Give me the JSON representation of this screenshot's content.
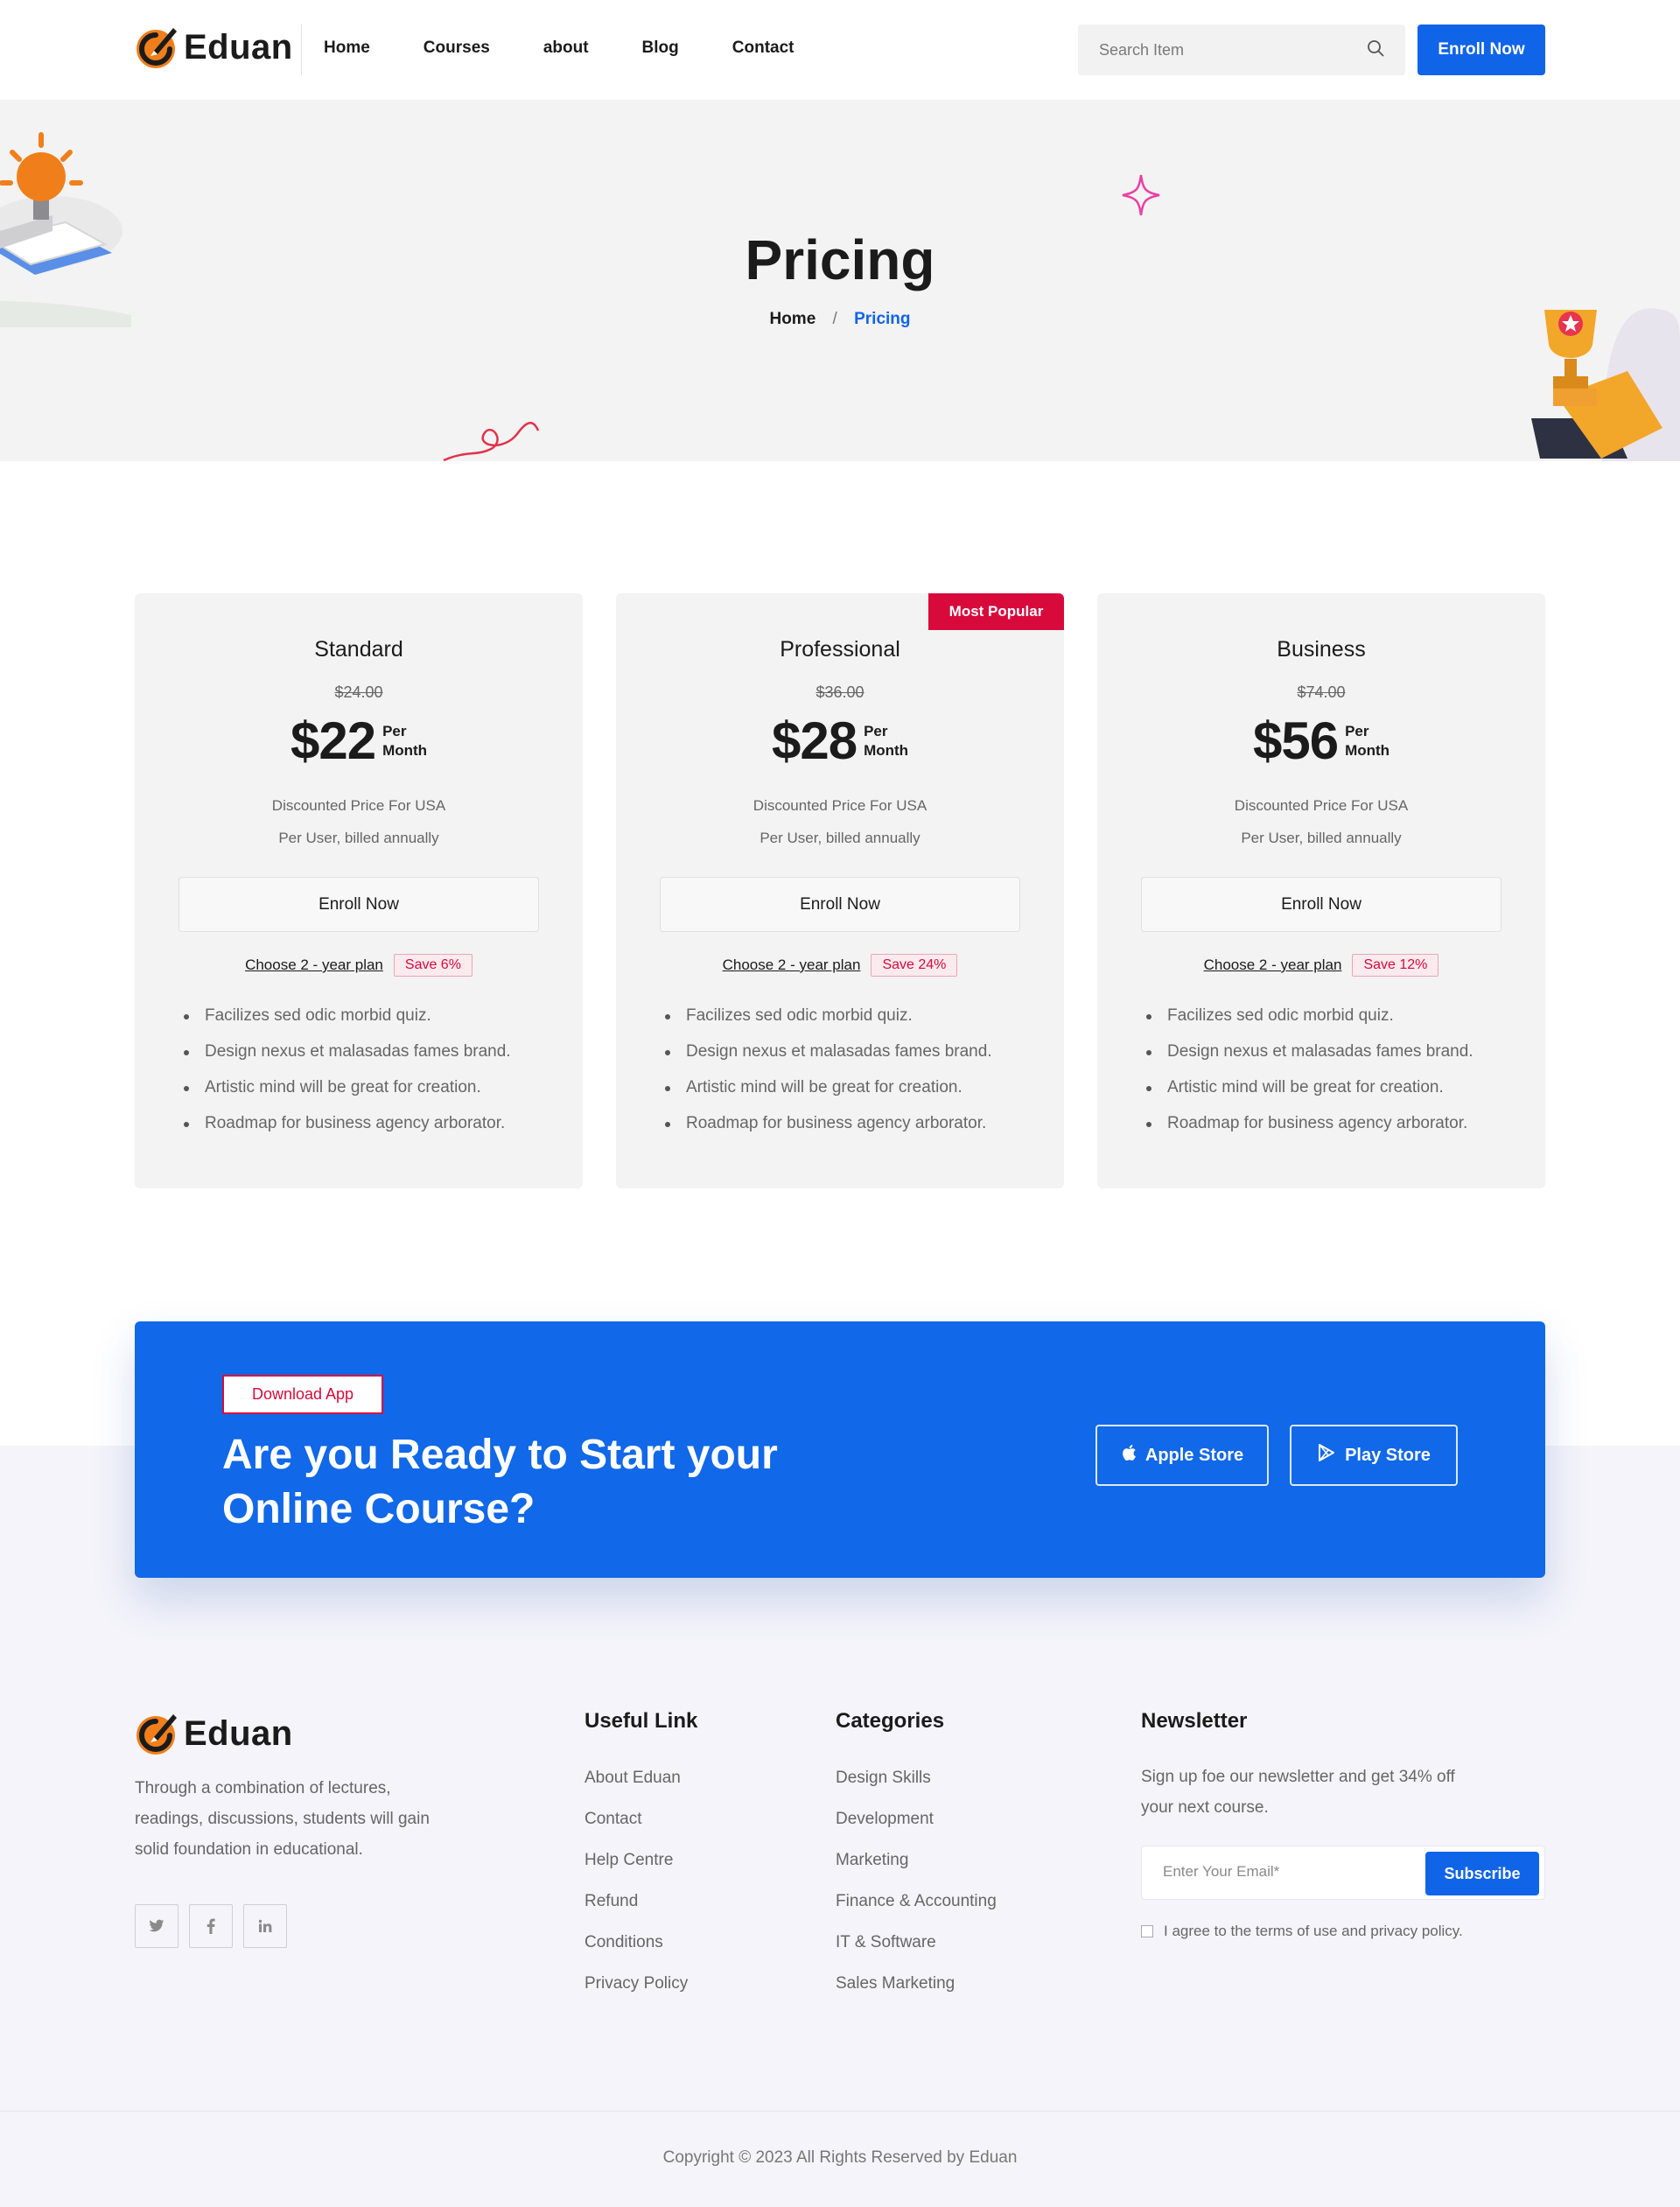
{
  "brand": {
    "name": "Eduan",
    "accent": "#1064e8",
    "orange": "#f07f1b",
    "red": "#d80a3c"
  },
  "nav": {
    "items": [
      "Home",
      "Courses",
      "about",
      "Blog",
      "Contact"
    ]
  },
  "header": {
    "search_placeholder": "Search Item",
    "enroll_label": "Enroll Now",
    "search_icon": "search-icon"
  },
  "hero": {
    "title": "Pricing",
    "breadcrumb": {
      "home": "Home",
      "separator": "/",
      "current": "Pricing"
    }
  },
  "pricing": {
    "badge": "Most Popular",
    "plans": [
      {
        "name": "Standard",
        "old_price": "$24.00",
        "price": "$22",
        "per_1": "Per",
        "per_2": "Month",
        "desc_1": "Discounted Price For USA",
        "desc_2": "Per User, billed annually",
        "button": "Enroll Now",
        "plan_link": "Choose 2 - year plan",
        "save": "Save 6%",
        "features": [
          "Facilizes sed odic morbid quiz.",
          "Design nexus et malasadas fames brand.",
          "Artistic mind will be great for creation.",
          "Roadmap for business agency arborator."
        ]
      },
      {
        "name": "Professional",
        "old_price": "$36.00",
        "price": "$28",
        "per_1": "Per",
        "per_2": "Month",
        "desc_1": "Discounted Price For USA",
        "desc_2": "Per User, billed annually",
        "button": "Enroll Now",
        "plan_link": "Choose 2 - year plan",
        "save": "Save 24%",
        "features": [
          "Facilizes sed odic morbid quiz.",
          "Design nexus et malasadas fames brand.",
          "Artistic mind will be great for creation.",
          "Roadmap for business agency arborator."
        ]
      },
      {
        "name": "Business",
        "old_price": "$74.00",
        "price": "$56",
        "per_1": "Per",
        "per_2": "Month",
        "desc_1": "Discounted Price For USA",
        "desc_2": "Per User, billed annually",
        "button": "Enroll Now",
        "plan_link": "Choose 2 - year plan",
        "save": "Save 12%",
        "features": [
          "Facilizes sed odic morbid quiz.",
          "Design nexus et malasadas fames brand.",
          "Artistic mind will be great for creation.",
          "Roadmap for business agency arborator."
        ]
      }
    ]
  },
  "cta": {
    "tag": "Download App",
    "title": "Are you Ready to Start your Online Course?",
    "apple": "Apple Store",
    "play": "Play Store"
  },
  "footer": {
    "about": "Through a combination of lectures, readings, discussions, students will gain solid foundation in educational.",
    "socials": [
      "twitter-icon",
      "facebook-icon",
      "linkedin-icon"
    ],
    "useful": {
      "title": "Useful Link",
      "items": [
        "About Eduan",
        "Contact",
        "Help Centre",
        "Refund",
        "Conditions",
        "Privacy Policy"
      ]
    },
    "categories": {
      "title": "Categories",
      "items": [
        "Design Skills",
        "Development",
        "Marketing",
        "Finance & Accounting",
        "IT & Software",
        "Sales Marketing"
      ]
    },
    "newsletter": {
      "title": "Newsletter",
      "text": "Sign up foe our newsletter and get 34% off your next course.",
      "placeholder": "Enter Your Email*",
      "button": "Subscribe",
      "agree": "I agree to the terms of use and privacy policy."
    },
    "copyright": "Copyright © 2023 All Rights Reserved by Eduan"
  }
}
